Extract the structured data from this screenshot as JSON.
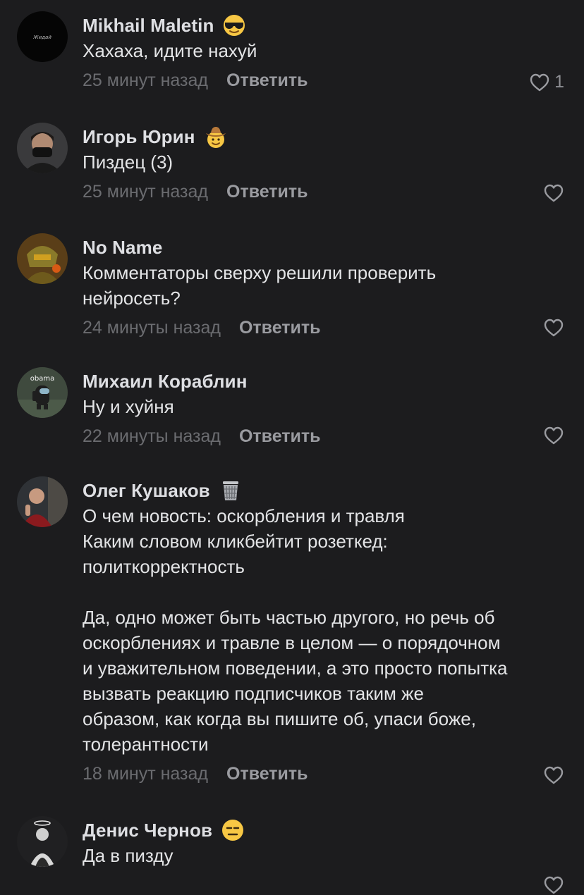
{
  "comments": [
    {
      "author": "Mikhail Maletin",
      "badge": "sunglasses-face-icon",
      "avatar_text": "Жидай",
      "text": "Хахаха, идите нахуй",
      "time": "25 минут назад",
      "reply_label": "Ответить",
      "likes": "1"
    },
    {
      "author": "Игорь Юрин",
      "badge": "cowboy-face-icon",
      "text": "Пиздец (3)",
      "time": "25 минут назад",
      "reply_label": "Ответить",
      "likes": ""
    },
    {
      "author": "No Name",
      "text": "Комментаторы сверху решили проверить\nнейросеть?",
      "time": "24 минуты назад",
      "reply_label": "Ответить",
      "likes": ""
    },
    {
      "author": "Михаил Кораблин",
      "avatar_text": "obama",
      "text": "Ну и хуйня",
      "time": "22 минуты назад",
      "reply_label": "Ответить",
      "likes": ""
    },
    {
      "author": "Олег Кушаков",
      "badge": "wastebasket-icon",
      "text": "О чем новость: оскорбления и травля\nКаким словом кликбейтит розеткед:\nполиткорректность\n\nДа, одно может быть частью другого, но речь об\nоскорблениях и травле в целом — о порядочном\nи уважительном поведении, а это просто попытка\nвызвать реакцию подписчиков таким же\nобразом, как когда вы пишите об, упаси боже,\nтолерантности",
      "time": "18 минут назад",
      "reply_label": "Ответить",
      "likes": ""
    },
    {
      "author": "Денис Чернов",
      "badge": "expressionless-face-icon",
      "text": "Да в пизду",
      "time": "",
      "reply_label": "",
      "likes": ""
    }
  ],
  "colors": {
    "background": "#1c1c1e",
    "author": "#dedfe3",
    "text": "#e3e4e6",
    "meta": "#6b6c70",
    "reply": "#9a9ba0",
    "heart": "#9a9ba0"
  }
}
